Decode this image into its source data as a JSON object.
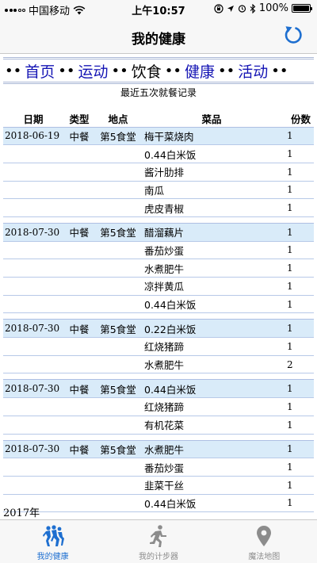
{
  "status_bar": {
    "carrier": "中国移动",
    "time": "上午10:57",
    "battery": "100%",
    "battery_level": 1.0
  },
  "nav": {
    "title": "我的健康",
    "refresh_icon": "refresh-icon"
  },
  "links": [
    {
      "label": "首页",
      "current": false
    },
    {
      "label": "运动",
      "current": false
    },
    {
      "label": "饮食",
      "current": true
    },
    {
      "label": "健康",
      "current": false
    },
    {
      "label": "活动",
      "current": false
    }
  ],
  "caption": "最近五次就餐记录",
  "table": {
    "headers": {
      "date": "日期",
      "type": "类型",
      "place": "地点",
      "food": "菜品",
      "qty": "份数"
    },
    "meals": [
      {
        "date": "2018-06-19",
        "type": "中餐",
        "place": "第5食堂",
        "items": [
          {
            "food": "梅干菜烧肉",
            "qty": "1"
          },
          {
            "food": "0.44白米饭",
            "qty": "1"
          },
          {
            "food": "酱汁肋排",
            "qty": "1"
          },
          {
            "food": "南瓜",
            "qty": "1"
          },
          {
            "food": "虎皮青椒",
            "qty": "1"
          }
        ]
      },
      {
        "date": "2018-07-30",
        "type": "中餐",
        "place": "第5食堂",
        "items": [
          {
            "food": "醋溜藕片",
            "qty": "1"
          },
          {
            "food": "番茄炒蛋",
            "qty": "1"
          },
          {
            "food": "水煮肥牛",
            "qty": "1"
          },
          {
            "food": "凉拌黄瓜",
            "qty": "1"
          },
          {
            "food": "0.44白米饭",
            "qty": "1"
          }
        ]
      },
      {
        "date": "2018-07-30",
        "type": "中餐",
        "place": "第5食堂",
        "items": [
          {
            "food": "0.22白米饭",
            "qty": "1"
          },
          {
            "food": "红烧猪蹄",
            "qty": "1"
          },
          {
            "food": "水煮肥牛",
            "qty": "2"
          }
        ]
      },
      {
        "date": "2018-07-30",
        "type": "中餐",
        "place": "第5食堂",
        "items": [
          {
            "food": "0.44白米饭",
            "qty": "1"
          },
          {
            "food": "红烧猪蹄",
            "qty": "1"
          },
          {
            "food": "有机花菜",
            "qty": "1"
          }
        ]
      },
      {
        "date": "2018-07-30",
        "type": "中餐",
        "place": "第5食堂",
        "items": [
          {
            "food": "水煮肥牛",
            "qty": "1"
          },
          {
            "food": "番茄炒蛋",
            "qty": "1"
          },
          {
            "food": "韭菜干丝",
            "qty": "1"
          },
          {
            "food": "0.44白米饭",
            "qty": "1"
          }
        ]
      }
    ]
  },
  "year_label": "2017年",
  "tabs": [
    {
      "label": "我的健康",
      "icon": "runners-group-icon",
      "active": true
    },
    {
      "label": "我的计步器",
      "icon": "runner-icon",
      "active": false
    },
    {
      "label": "魔法地图",
      "icon": "map-pin-icon",
      "active": false
    }
  ],
  "colors": {
    "accent": "#1e6fd0",
    "link": "#1414b4",
    "row_highlight": "#d9ebf9",
    "row_rule": "#b7c9e8"
  }
}
